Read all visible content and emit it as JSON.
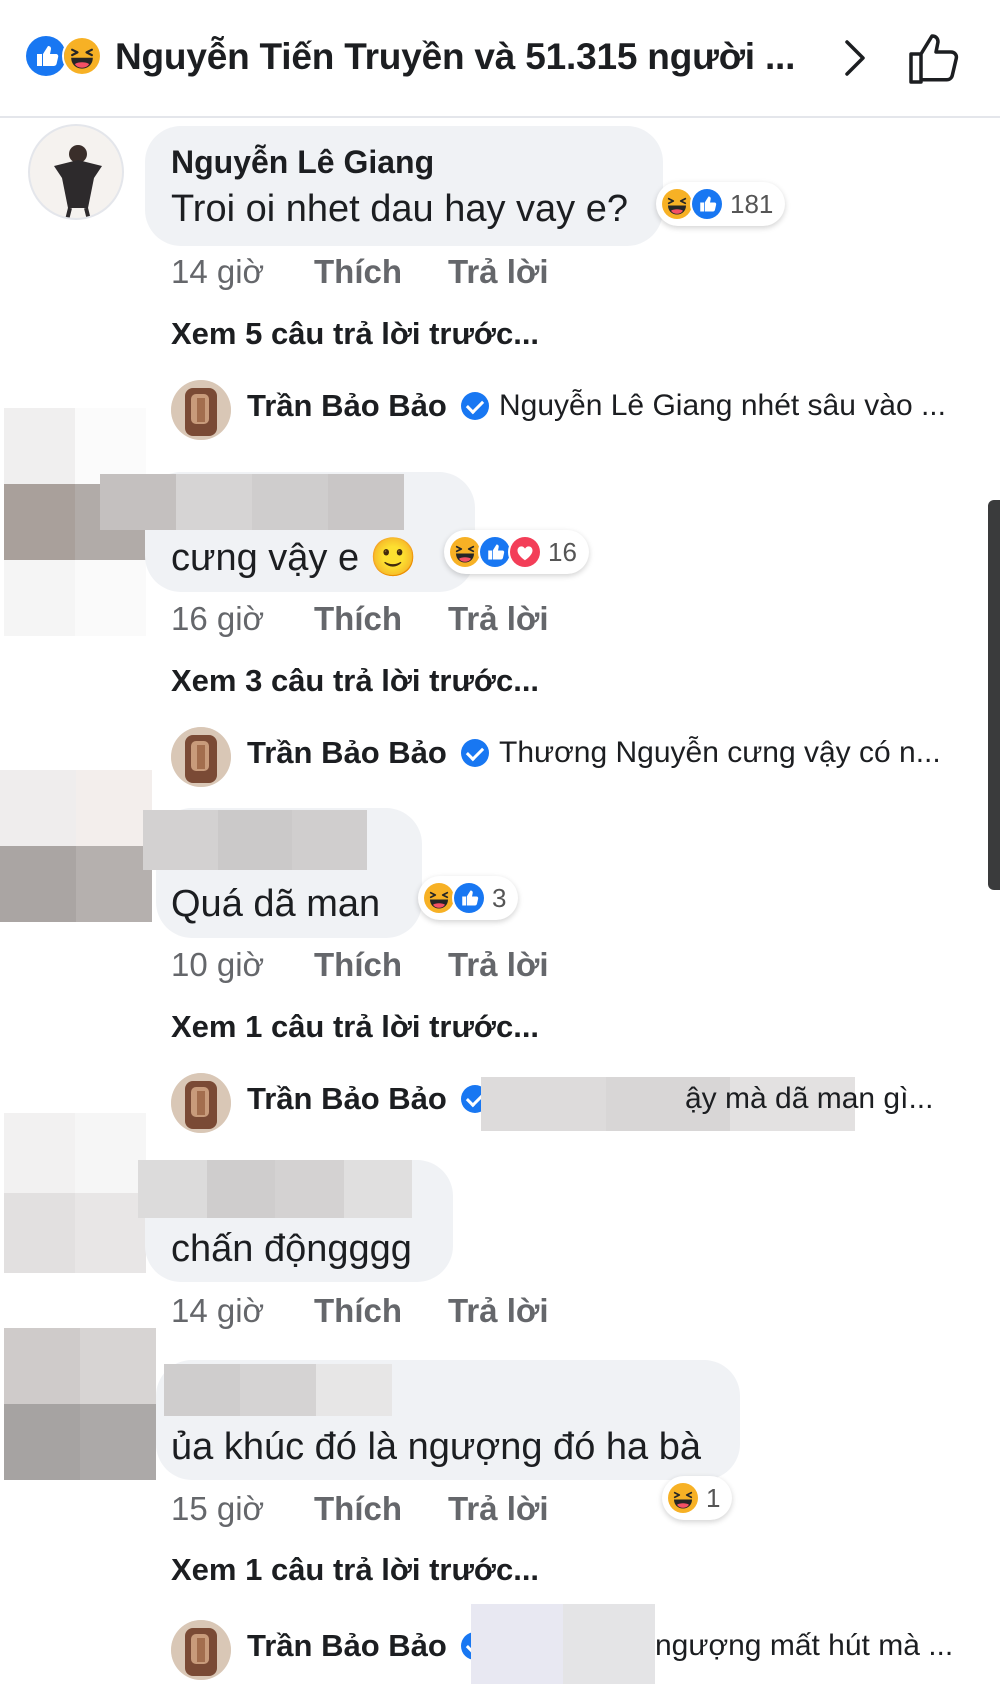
{
  "header": {
    "reactions_summary": "Nguyễn Tiến Truyền và 51.315 người ...",
    "reaction_icons": [
      "like-icon",
      "haha-icon"
    ]
  },
  "comments": [
    {
      "author": "Nguyễn Lê Giang",
      "text": "Troi oi nhet dau hay vay e?",
      "reaction_count": "181",
      "time": "14 giờ",
      "like_label": "Thích",
      "reply_label": "Trả lời",
      "view_previous": "Xem 5 câu trả lời trước...",
      "reply_preview": {
        "author": "Trần Bảo Bảo",
        "text": "Nguyễn Lê Giang nhét sâu vào ..."
      }
    },
    {
      "author": "",
      "text": "cưng vậy e 🙂",
      "reaction_count": "16",
      "time": "16 giờ",
      "like_label": "Thích",
      "reply_label": "Trả lời",
      "view_previous": "Xem 3 câu trả lời trước...",
      "reply_preview": {
        "author": "Trần Bảo Bảo",
        "text": "Thương Nguyễn cưng vậy có n..."
      }
    },
    {
      "author": "",
      "text": "Quá dã man",
      "reaction_count": "3",
      "time": "10 giờ",
      "like_label": "Thích",
      "reply_label": "Trả lời",
      "view_previous": "Xem 1 câu trả lời trước...",
      "reply_preview": {
        "author": "Trần Bảo Bảo",
        "text": "ậy mà dã man gì..."
      }
    },
    {
      "author": "",
      "text": "chấn độngggg",
      "time": "14 giờ",
      "like_label": "Thích",
      "reply_label": "Trả lời"
    },
    {
      "author": "",
      "text": "ủa khúc đó là ngượng đó ha bà",
      "reaction_count": "1",
      "time": "15 giờ",
      "like_label": "Thích",
      "reply_label": "Trả lời",
      "view_previous": "Xem 1 câu trả lời trước...",
      "reply_preview": {
        "author": "Trần Bảo Bảo",
        "text": "ngượng mất hút mà ..."
      }
    }
  ],
  "colors": {
    "like_blue": "#1877f2",
    "love_red": "#f33e58",
    "haha_yellow": "#f7b125",
    "bubble_gray": "#f0f2f5",
    "meta_gray": "#65676b"
  }
}
